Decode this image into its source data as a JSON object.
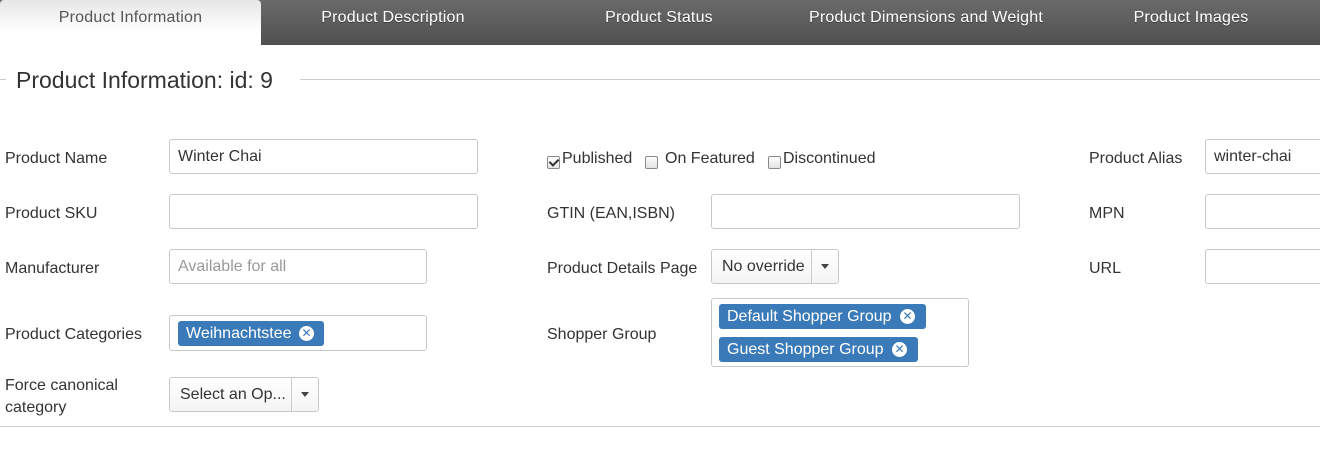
{
  "tabs": [
    {
      "label": "Product Information",
      "active": true
    },
    {
      "label": "Product Description",
      "active": false
    },
    {
      "label": "Product Status",
      "active": false
    },
    {
      "label": "Product Dimensions and Weight",
      "active": false
    },
    {
      "label": "Product Images",
      "active": false
    }
  ],
  "legend": "Product Information: id: 9",
  "fields": {
    "product_name": {
      "label": "Product Name",
      "value": "Winter Chai"
    },
    "product_sku": {
      "label": "Product SKU",
      "value": ""
    },
    "manufacturer": {
      "label": "Manufacturer",
      "placeholder": "Available for all"
    },
    "product_categories": {
      "label": "Product Categories",
      "chips": [
        "Weihnachtstee"
      ]
    },
    "force_canonical": {
      "label": "Force canonical category",
      "value": "Select an Op..."
    },
    "published": {
      "label": "Published",
      "checked": true
    },
    "on_featured": {
      "label": "On Featured",
      "checked": false
    },
    "discontinued": {
      "label": "Discontinued",
      "checked": false
    },
    "gtin": {
      "label": "GTIN (EAN,ISBN)",
      "value": ""
    },
    "product_details_page": {
      "label": "Product Details Page",
      "value": "No override"
    },
    "shopper_group": {
      "label": "Shopper Group",
      "chips": [
        "Default Shopper Group",
        "Guest Shopper Group"
      ]
    },
    "product_alias": {
      "label": "Product Alias",
      "value": "winter-chai"
    },
    "mpn": {
      "label": "MPN",
      "value": ""
    },
    "url": {
      "label": "URL",
      "value": ""
    }
  },
  "icons": {
    "chip_remove": "close-circle-icon",
    "select_arrow": "caret-down-icon",
    "checkmark": "check-icon"
  },
  "colors": {
    "tabbar": "#5a5a5a",
    "chip": "#3a7ab8",
    "border": "#c8c8c8"
  }
}
